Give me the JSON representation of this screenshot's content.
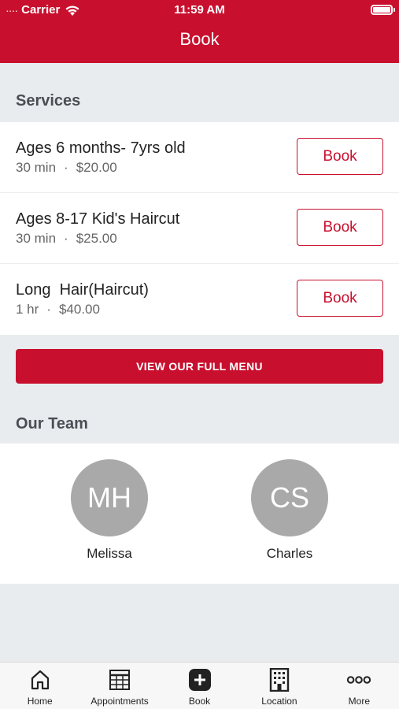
{
  "status_bar": {
    "signal": "....",
    "carrier": "Carrier",
    "time": "11:59 AM"
  },
  "header": {
    "title": "Book"
  },
  "services": {
    "heading": "Services",
    "items": [
      {
        "name": "Ages 6 months- 7yrs old",
        "duration": "30 min",
        "separator": "·",
        "price": "$20.00",
        "button": "Book"
      },
      {
        "name": "Ages 8-17 Kid's Haircut",
        "duration": "30 min",
        "separator": "·",
        "price": "$25.00",
        "button": "Book"
      },
      {
        "name": "Long  Hair(Haircut)",
        "duration": "1 hr",
        "separator": "·",
        "price": "$40.00",
        "button": "Book"
      }
    ],
    "full_menu_label": "VIEW OUR FULL MENU"
  },
  "team": {
    "heading": "Our Team",
    "members": [
      {
        "initials": "MH",
        "name": "Melissa"
      },
      {
        "initials": "CS",
        "name": "Charles"
      }
    ]
  },
  "tab_bar": {
    "items": [
      {
        "label": "Home",
        "icon": "home-icon"
      },
      {
        "label": "Appointments",
        "icon": "calendar-grid-icon"
      },
      {
        "label": "Book",
        "icon": "plus-square-icon"
      },
      {
        "label": "Location",
        "icon": "building-icon"
      },
      {
        "label": "More",
        "icon": "more-dots-icon"
      }
    ]
  },
  "colors": {
    "brand": "#c8102e",
    "background": "#e9ecef",
    "avatar": "#a9a9a9"
  }
}
